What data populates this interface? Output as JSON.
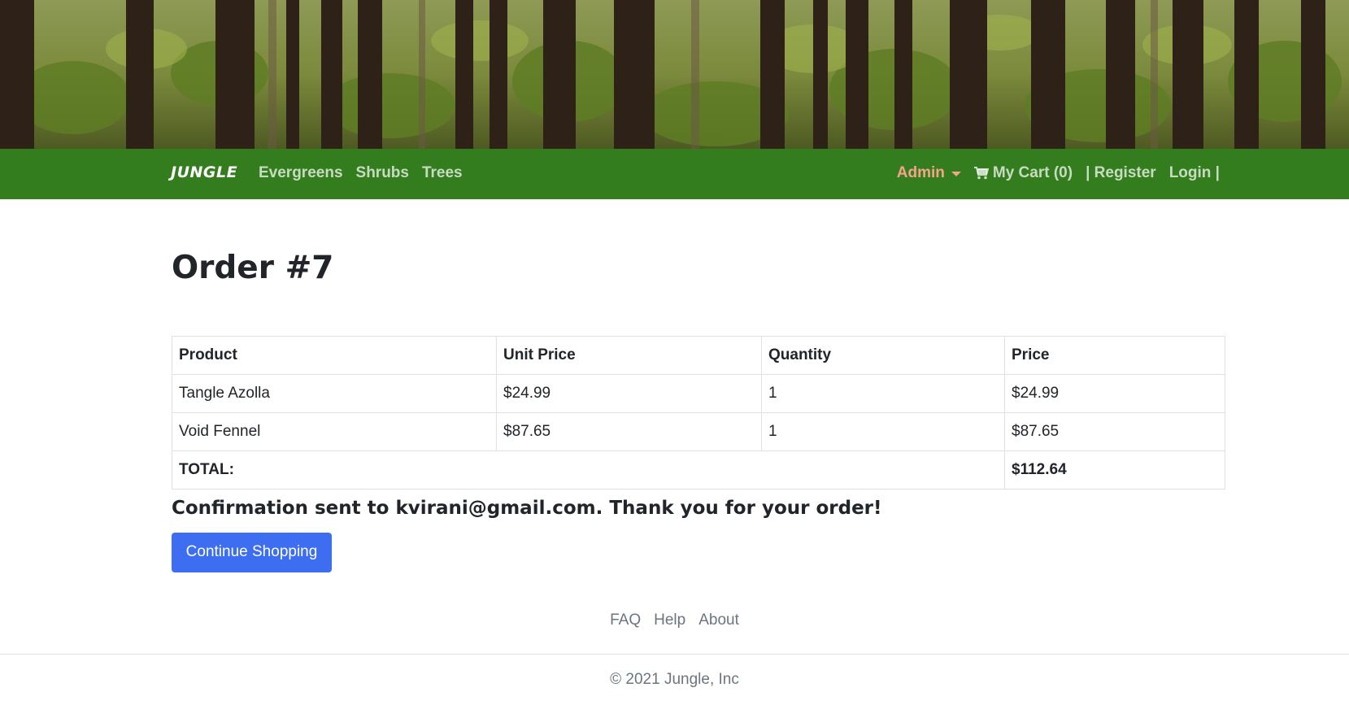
{
  "hero": {
    "image_desc": "forest-banner-image"
  },
  "navbar": {
    "brand": "JUNGLE",
    "links": [
      "Evergreens",
      "Shrubs",
      "Trees"
    ],
    "admin_label": "Admin",
    "cart_label": "My Cart (0)",
    "register_label": "| Register",
    "login_label": "Login |",
    "colors": {
      "background": "#337d1e",
      "admin": "#f3a48b"
    }
  },
  "order": {
    "title": "Order #7",
    "table": {
      "headers": [
        "Product",
        "Unit Price",
        "Quantity",
        "Price"
      ],
      "rows": [
        {
          "product": "Tangle Azolla",
          "unit_price": "$24.99",
          "quantity": "1",
          "price": "$24.99"
        },
        {
          "product": "Void Fennel",
          "unit_price": "$87.65",
          "quantity": "1",
          "price": "$87.65"
        }
      ],
      "total_label": "TOTAL:",
      "total_value": "$112.64"
    },
    "confirmation": "Confirmation sent to kvirani@gmail.com. Thank you for your order!",
    "continue_button": "Continue Shopping"
  },
  "footer": {
    "links": [
      "FAQ",
      "Help",
      "About"
    ],
    "copyright": "© 2021 Jungle, Inc"
  },
  "colors": {
    "accent_button": "#3d6ef2",
    "muted_text": "#6c757d"
  }
}
